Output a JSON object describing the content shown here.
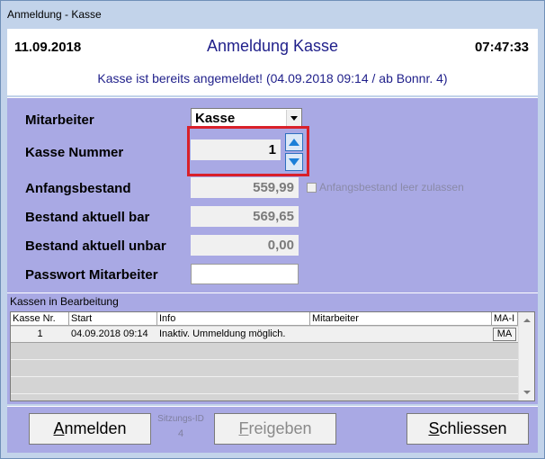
{
  "window": {
    "title": "Anmeldung - Kasse"
  },
  "header": {
    "date": "11.09.2018",
    "title": "Anmeldung Kasse",
    "time": "07:47:33",
    "status": "Kasse ist bereits angemeldet! (04.09.2018 09:14 / ab Bonnr. 4)"
  },
  "form": {
    "mitarbeiter_label": "Mitarbeiter",
    "mitarbeiter_value": "Kasse",
    "kasse_nummer_label": "Kasse Nummer",
    "kasse_nummer_value": "1",
    "anfangsbestand_label": "Anfangsbestand",
    "anfangsbestand_value": "559,99",
    "anfangsbestand_checkbox_label": "Anfangsbestand leer zulassen",
    "bestand_bar_label": "Bestand aktuell bar",
    "bestand_bar_value": "569,65",
    "bestand_unbar_label": "Bestand aktuell unbar",
    "bestand_unbar_value": "0,00",
    "passwort_label": "Passwort Mitarbeiter",
    "passwort_value": ""
  },
  "kassen": {
    "title": "Kassen in Bearbeitung",
    "columns": [
      "Kasse Nr.",
      "Start",
      "Info",
      "Mitarbeiter",
      "MA-I"
    ],
    "rows": [
      {
        "kasse_nr": "1",
        "start": "04.09.2018 09:14",
        "info": "Inaktiv. Ummeldung möglich.",
        "mitarbeiter": "",
        "button": "MA"
      }
    ]
  },
  "footer": {
    "anmelden_u": "A",
    "anmelden_rest": "nmelden",
    "sitzungs_label": "Sitzungs-ID",
    "sitzungs_value": "4",
    "freigeben_u": "F",
    "freigeben_rest": "reigeben",
    "schliessen_u": "S",
    "schliessen_rest": "chliessen"
  },
  "colors": {
    "panel": "#a9a9e4",
    "header_text": "#1f1f8a",
    "highlight": "#d9202a"
  }
}
